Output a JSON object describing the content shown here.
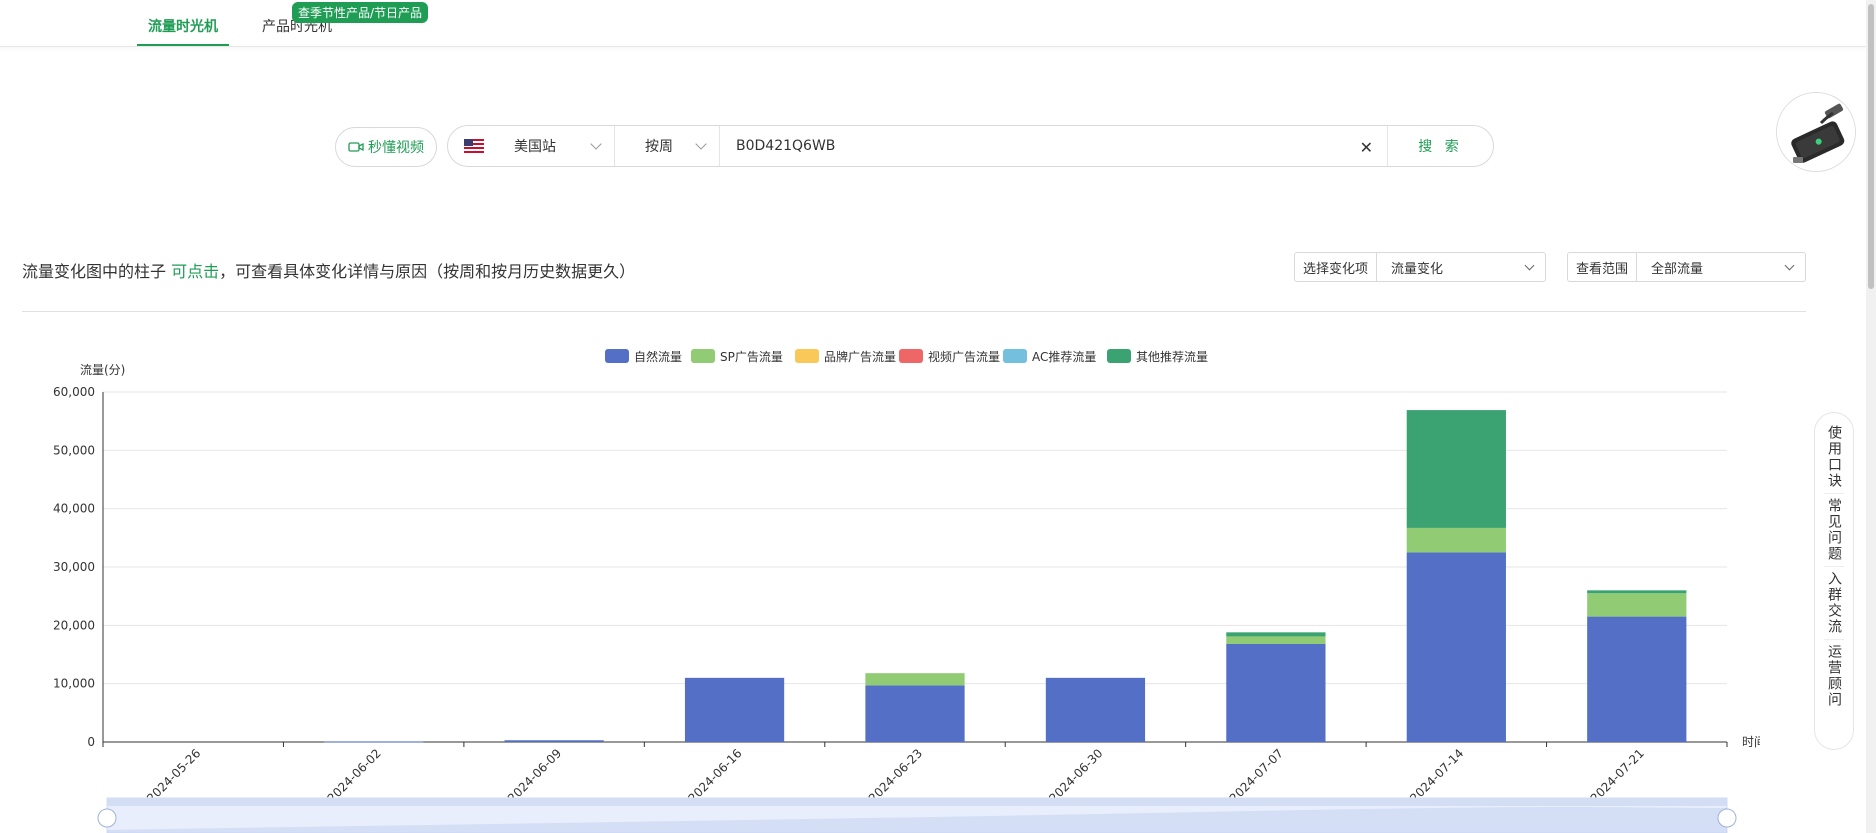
{
  "top_tabs": [
    {
      "label": "流量时光机",
      "active": true
    },
    {
      "label": "产品时光机",
      "active": false
    }
  ],
  "promo_badge": "查季节性产品/节日产品",
  "video_button": {
    "label": "秒懂视频"
  },
  "search": {
    "site": "美国站",
    "period": "按周",
    "asin": "B0D421Q6WB",
    "button": "搜 索"
  },
  "hint": {
    "part1": "流量变化图中的柱子 ",
    "highlight": "可点击",
    "part2": "，可查看具体变化详情与原因（按周和按月历史数据更久）"
  },
  "select_change": {
    "label": "选择变化项",
    "value": "流量变化"
  },
  "select_range": {
    "label": "查看范围",
    "value": "全部流量"
  },
  "side_panel": [
    "使用口诀",
    "常见问题",
    "入群交流",
    "运营顾问"
  ],
  "colors": {
    "accent": "#1f9d55",
    "organic": "#5470c6",
    "sp": "#91cc75",
    "brand": "#fac858",
    "video": "#ee6666",
    "ac": "#73c0de",
    "other": "#3ba272"
  },
  "chart_data": {
    "type": "bar",
    "stacked": true,
    "ylabel": "流量(分)",
    "xlabel": "时间",
    "ylim": [
      0,
      60000
    ],
    "yticks": [
      0,
      10000,
      20000,
      30000,
      40000,
      50000,
      60000
    ],
    "ytick_labels": [
      "0",
      "10,000",
      "20,000",
      "30,000",
      "40,000",
      "50,000",
      "60,000"
    ],
    "legend_position": "top-center",
    "categories": [
      "2024-05-26",
      "2024-06-02",
      "2024-06-09",
      "2024-06-16",
      "2024-06-23",
      "2024-06-30",
      "2024-07-07",
      "2024-07-14",
      "2024-07-21"
    ],
    "series": [
      {
        "name": "自然流量",
        "color": "#5470c6",
        "values": [
          0,
          100,
          300,
          11000,
          9700,
          11000,
          16800,
          32500,
          21500
        ]
      },
      {
        "name": "SP广告流量",
        "color": "#91cc75",
        "values": [
          0,
          0,
          0,
          0,
          2100,
          0,
          1300,
          4200,
          4000
        ]
      },
      {
        "name": "品牌广告流量",
        "color": "#fac858",
        "values": [
          0,
          0,
          0,
          0,
          0,
          0,
          0,
          0,
          0
        ]
      },
      {
        "name": "视频广告流量",
        "color": "#ee6666",
        "values": [
          0,
          0,
          0,
          0,
          0,
          0,
          0,
          0,
          0
        ]
      },
      {
        "name": "AC推荐流量",
        "color": "#73c0de",
        "values": [
          0,
          0,
          0,
          0,
          0,
          0,
          0,
          0,
          0
        ]
      },
      {
        "name": "其他推荐流量",
        "color": "#3ba272",
        "values": [
          0,
          0,
          0,
          0,
          0,
          0,
          700,
          20200,
          500
        ]
      }
    ]
  }
}
